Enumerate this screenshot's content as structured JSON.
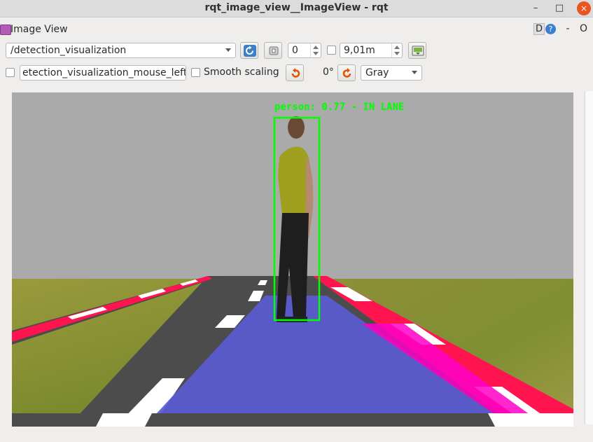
{
  "window": {
    "title": "rqt_image_view__ImageView - rqt",
    "minimize_glyph": "–",
    "maximize_glyph": "□",
    "close_glyph": "×"
  },
  "panel": {
    "title": "Image View",
    "d_label": "D",
    "help_label": "?",
    "dash_label": "-",
    "o_label": "O"
  },
  "toolbar": {
    "topic": "/detection_visualization",
    "spin_value": "0",
    "zoom_value": "9,01m",
    "mouse_topic": "etection_visualization_mouse_left",
    "smooth_scaling_label": "Smooth scaling",
    "rotation_label": "0°",
    "color_scheme": "Gray"
  },
  "image": {
    "detection_label": "person: 0.77 - IN LANE",
    "box_color": "#00ff00",
    "lane_overlay_color": "#5a5ad2"
  },
  "icons": [
    "refresh-icon",
    "snapshot-icon",
    "save-image-icon",
    "rotate-left-icon",
    "rotate-right-icon",
    "image-view-icon"
  ]
}
